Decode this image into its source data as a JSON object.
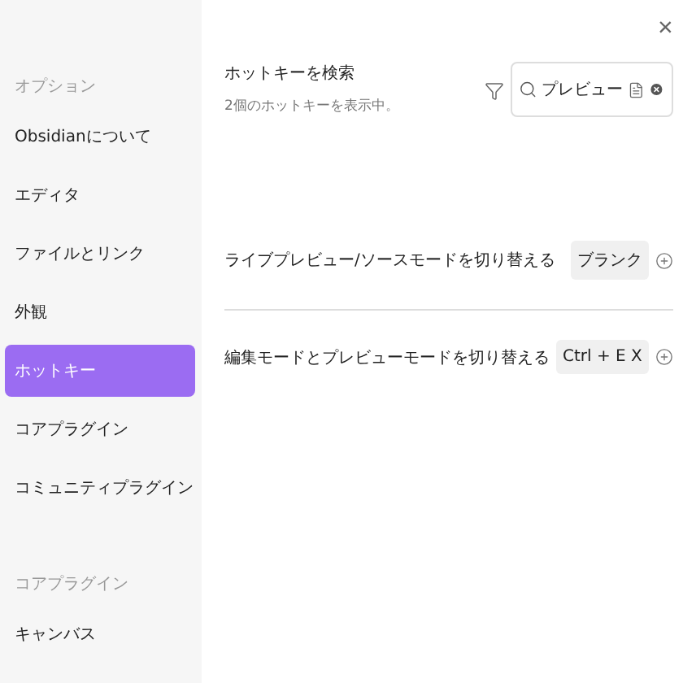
{
  "sidebar": {
    "sections": [
      {
        "heading": "オプション",
        "items": [
          {
            "label": "Obsidianについて",
            "selected": false
          },
          {
            "label": "エディタ",
            "selected": false
          },
          {
            "label": "ファイルとリンク",
            "selected": false
          },
          {
            "label": "外観",
            "selected": false
          },
          {
            "label": "ホットキー",
            "selected": true
          },
          {
            "label": "コアプラグイン",
            "selected": false
          },
          {
            "label": "コミュニティプラグイン",
            "selected": false
          }
        ]
      },
      {
        "heading": "コアプラグイン",
        "items": [
          {
            "label": "キャンバス",
            "selected": false
          }
        ]
      }
    ]
  },
  "close": "×",
  "header": {
    "title": "ホットキーを検索",
    "subtitle": "2個のホットキーを表示中。",
    "search": {
      "value": "プレビュー"
    }
  },
  "hotkeys": [
    {
      "name": "ライブプレビュー/ソースモードを切り替える",
      "binding": "ブランク"
    },
    {
      "name": "編集モードとプレビューモードを切り替える",
      "binding": "Ctrl + E X"
    }
  ]
}
